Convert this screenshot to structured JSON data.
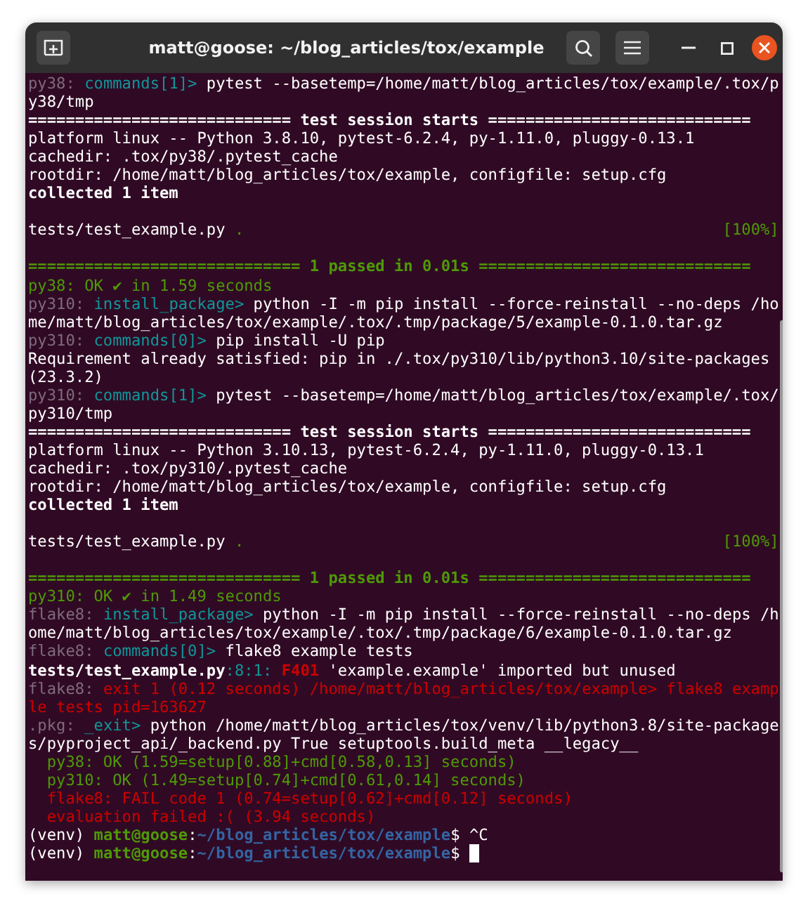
{
  "window": {
    "title": "matt@goose: ~/blog_articles/tox/example"
  },
  "terminal": {
    "lines": [
      {
        "kind": "text",
        "segments": [
          {
            "text": "py38:",
            "kind": "env"
          },
          {
            "text": " commands[1]>",
            "kind": "step"
          },
          {
            "text": " pytest --basetemp=/home/matt/blog_articles/tox/example/.tox/p",
            "kind": "plain"
          }
        ]
      },
      {
        "kind": "text",
        "segments": [
          {
            "text": "y38/tmp",
            "kind": "plain"
          }
        ]
      },
      {
        "kind": "text",
        "segments": [
          {
            "text": "============================ test session starts ============================",
            "kind": "strong"
          }
        ]
      },
      {
        "kind": "text",
        "segments": [
          {
            "text": "platform linux -- Python 3.8.10, pytest-6.2.4, py-1.11.0, pluggy-0.13.1",
            "kind": "plain"
          }
        ]
      },
      {
        "kind": "text",
        "segments": [
          {
            "text": "cachedir: .tox/py38/.pytest_cache",
            "kind": "plain"
          }
        ]
      },
      {
        "kind": "text",
        "segments": [
          {
            "text": "rootdir: /home/matt/blog_articles/tox/example, configfile: setup.cfg",
            "kind": "plain"
          }
        ]
      },
      {
        "kind": "text",
        "segments": [
          {
            "text": "collected 1 item",
            "kind": "strong"
          }
        ]
      },
      {
        "kind": "blank"
      },
      {
        "kind": "text",
        "segments": [
          {
            "text": "tests/test_example.py",
            "kind": "plain"
          },
          {
            "text": " .",
            "kind": "success"
          }
        ],
        "right": {
          "text": "[100%]",
          "kind": "success"
        }
      },
      {
        "kind": "blank"
      },
      {
        "kind": "text",
        "segments": [
          {
            "text": "============================= 1 passed in 0.01s =============================",
            "kind": "success-strong"
          }
        ]
      },
      {
        "kind": "text",
        "segments": [
          {
            "text": "py38: OK ✔ in 1.59 seconds",
            "kind": "success"
          }
        ]
      },
      {
        "kind": "text",
        "segments": [
          {
            "text": "py310:",
            "kind": "env"
          },
          {
            "text": " install_package>",
            "kind": "step"
          },
          {
            "text": " python -I -m pip install --force-reinstall --no-deps /ho",
            "kind": "plain"
          }
        ]
      },
      {
        "kind": "text",
        "segments": [
          {
            "text": "me/matt/blog_articles/tox/example/.tox/.tmp/package/5/example-0.1.0.tar.gz",
            "kind": "plain"
          }
        ]
      },
      {
        "kind": "text",
        "segments": [
          {
            "text": "py310:",
            "kind": "env"
          },
          {
            "text": " commands[0]>",
            "kind": "step"
          },
          {
            "text": " pip install -U pip",
            "kind": "plain"
          }
        ]
      },
      {
        "kind": "text",
        "segments": [
          {
            "text": "Requirement already satisfied: pip in ./.tox/py310/lib/python3.10/site-packages",
            "kind": "plain"
          }
        ]
      },
      {
        "kind": "text",
        "segments": [
          {
            "text": "(23.3.2)",
            "kind": "plain"
          }
        ]
      },
      {
        "kind": "text",
        "segments": [
          {
            "text": "py310:",
            "kind": "env"
          },
          {
            "text": " commands[1]>",
            "kind": "step"
          },
          {
            "text": " pytest --basetemp=/home/matt/blog_articles/tox/example/.tox/",
            "kind": "plain"
          }
        ]
      },
      {
        "kind": "text",
        "segments": [
          {
            "text": "py310/tmp",
            "kind": "plain"
          }
        ]
      },
      {
        "kind": "text",
        "segments": [
          {
            "text": "============================ test session starts ============================",
            "kind": "strong"
          }
        ]
      },
      {
        "kind": "text",
        "segments": [
          {
            "text": "platform linux -- Python 3.10.13, pytest-6.2.4, py-1.11.0, pluggy-0.13.1",
            "kind": "plain"
          }
        ]
      },
      {
        "kind": "text",
        "segments": [
          {
            "text": "cachedir: .tox/py310/.pytest_cache",
            "kind": "plain"
          }
        ]
      },
      {
        "kind": "text",
        "segments": [
          {
            "text": "rootdir: /home/matt/blog_articles/tox/example, configfile: setup.cfg",
            "kind": "plain"
          }
        ]
      },
      {
        "kind": "text",
        "segments": [
          {
            "text": "collected 1 item",
            "kind": "strong"
          }
        ]
      },
      {
        "kind": "blank"
      },
      {
        "kind": "text",
        "segments": [
          {
            "text": "tests/test_example.py",
            "kind": "plain"
          },
          {
            "text": " .",
            "kind": "success"
          }
        ],
        "right": {
          "text": "[100%]",
          "kind": "success"
        }
      },
      {
        "kind": "blank"
      },
      {
        "kind": "text",
        "segments": [
          {
            "text": "============================= 1 passed in 0.01s =============================",
            "kind": "success-strong"
          }
        ]
      },
      {
        "kind": "text",
        "segments": [
          {
            "text": "py310: OK ✔ in 1.49 seconds",
            "kind": "success"
          }
        ]
      },
      {
        "kind": "text",
        "segments": [
          {
            "text": "flake8:",
            "kind": "env"
          },
          {
            "text": " install_package>",
            "kind": "step"
          },
          {
            "text": " python -I -m pip install --force-reinstall --no-deps /h",
            "kind": "plain"
          }
        ]
      },
      {
        "kind": "text",
        "segments": [
          {
            "text": "ome/matt/blog_articles/tox/example/.tox/.tmp/package/6/example-0.1.0.tar.gz",
            "kind": "plain"
          }
        ]
      },
      {
        "kind": "text",
        "segments": [
          {
            "text": "flake8:",
            "kind": "env"
          },
          {
            "text": " commands[0]>",
            "kind": "step"
          },
          {
            "text": " flake8 example tests",
            "kind": "plain"
          }
        ]
      },
      {
        "kind": "text",
        "segments": [
          {
            "text": "tests/test_example.py",
            "kind": "strong"
          },
          {
            "text": ":8:1: ",
            "kind": "step"
          },
          {
            "text": "F401",
            "kind": "error-strong"
          },
          {
            "text": " 'example.example' imported but unused",
            "kind": "plain"
          }
        ]
      },
      {
        "kind": "text",
        "segments": [
          {
            "text": "flake8:",
            "kind": "env"
          },
          {
            "text": " exit 1 (0.12 seconds) /home/matt/blog_articles/tox/example> flake8 examp",
            "kind": "error"
          }
        ]
      },
      {
        "kind": "text",
        "segments": [
          {
            "text": "le tests pid=163627",
            "kind": "error"
          }
        ]
      },
      {
        "kind": "text",
        "segments": [
          {
            "text": ".pkg:",
            "kind": "env"
          },
          {
            "text": " _exit>",
            "kind": "step"
          },
          {
            "text": " python /home/matt/blog_articles/tox/venv/lib/python3.8/site-package",
            "kind": "plain"
          }
        ]
      },
      {
        "kind": "text",
        "segments": [
          {
            "text": "s/pyproject_api/_backend.py True setuptools.build_meta __legacy__",
            "kind": "plain"
          }
        ]
      },
      {
        "kind": "text",
        "segments": [
          {
            "text": "  py38: OK (1.59=setup[0.88]+cmd[0.58,0.13] seconds)",
            "kind": "success"
          }
        ]
      },
      {
        "kind": "text",
        "segments": [
          {
            "text": "  py310: OK (1.49=setup[0.74]+cmd[0.61,0.14] seconds)",
            "kind": "success"
          }
        ]
      },
      {
        "kind": "text",
        "segments": [
          {
            "text": "  flake8: FAIL code 1 (0.74=setup[0.62]+cmd[0.12] seconds)",
            "kind": "error"
          }
        ]
      },
      {
        "kind": "text",
        "segments": [
          {
            "text": "  evaluation failed :( (3.94 seconds)",
            "kind": "error"
          }
        ]
      },
      {
        "kind": "text",
        "segments": [
          {
            "text": "(venv) ",
            "kind": "plain"
          },
          {
            "text": "matt@goose",
            "kind": "success-strong"
          },
          {
            "text": ":",
            "kind": "plain"
          },
          {
            "text": "~/blog_articles/tox/example",
            "kind": "path"
          },
          {
            "text": "$ ^C",
            "kind": "plain"
          }
        ]
      },
      {
        "kind": "text",
        "segments": [
          {
            "text": "(venv) ",
            "kind": "plain"
          },
          {
            "text": "matt@goose",
            "kind": "success-strong"
          },
          {
            "text": ":",
            "kind": "plain"
          },
          {
            "text": "~/blog_articles/tox/example",
            "kind": "path"
          },
          {
            "text": "$",
            "kind": "plain"
          }
        ],
        "cursor": true
      }
    ]
  }
}
